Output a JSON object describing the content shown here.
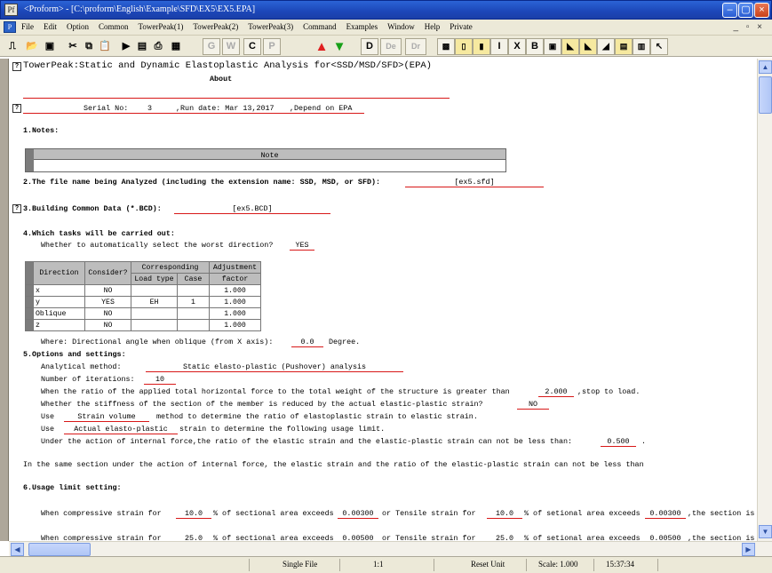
{
  "window": {
    "title": "<Proform> - [C:\\proform\\English\\Example\\SFD\\EX5\\EX5.EPA]",
    "app_icon": "Pf"
  },
  "menu": [
    "File",
    "Edit",
    "Option",
    "Common",
    "TowerPeak(1)",
    "TowerPeak(2)",
    "TowerPeak(3)",
    "Command",
    "Examples",
    "Window",
    "Help",
    "Private"
  ],
  "menu_controls": "_ ▫ ×",
  "toolbar": {
    "g": "G",
    "w": "W",
    "c1": "C",
    "p": "P",
    "d": "D",
    "de": "De",
    "dr": "Dr",
    "i": "I",
    "x": "X",
    "b": "B"
  },
  "doc": {
    "title": "TowerPeak:Static and Dynamic Elastoplastic Analysis for<SSD/MSD/SFD>(EPA)",
    "about": "About",
    "serial_label": "Serial No:",
    "serial_value": "3",
    "run_date": ",Run date: Mar 13,2017",
    "depend": ",Depend on  EPA",
    "s1": "1.Notes:",
    "note_header": "Note",
    "s2": "2.The file name being Analyzed (including the extension name: SSD, MSD, or SFD):",
    "s2_value": "[ex5.sfd]",
    "s3": "3.Building Common Data (*.BCD):",
    "s3_value": "[ex5.BCD]",
    "s4": "4.Which tasks will be carried out:",
    "s4_q": "Whether to automatically select the worst direction?",
    "s4_a": "YES",
    "table": {
      "h_direction": "Direction",
      "h_consider": "Consider?",
      "h_corr": "Corresponding",
      "h_adj": "Adjustment",
      "h_loadtype": "Load type",
      "h_case": "Case",
      "h_factor": "factor",
      "rows": [
        {
          "dir": "x",
          "consider": "NO",
          "load": "",
          "case": "",
          "factor": "1.000"
        },
        {
          "dir": "y",
          "consider": "YES",
          "load": "EH",
          "case": "1",
          "factor": "1.000"
        },
        {
          "dir": "Oblique",
          "consider": "NO",
          "load": "",
          "case": "",
          "factor": "1.000"
        },
        {
          "dir": "z",
          "consider": "NO",
          "load": "",
          "case": "",
          "factor": "1.000"
        }
      ]
    },
    "where": "Where: Directional angle when oblique (from X axis):",
    "where_value": "0.0",
    "where_unit": "Degree.",
    "s5": "5.Options and settings:",
    "method_label": "Analytical method:",
    "method_value": "Static elasto-plastic (Pushover) analysis",
    "iter_label": "Number of iterations:",
    "iter_value": "10",
    "ratio_pre": "When the ratio of the applied total horizontal force to the total weight of the structure is greater than",
    "ratio_value": "2.000",
    "ratio_post": ",stop to load.",
    "stiff_pre": "Whether the stiffness of the section of the member is reduced by the actual elastic-plastic strain?",
    "stiff_value": "NO",
    "use1_pre": "Use",
    "use1_value": "Strain volume",
    "use1_post": "method to determine the ratio of elastoplastic strain to elastic strain.",
    "use2_pre": "Use",
    "use2_value": "Actual elasto-plastic",
    "use2_post": "strain to determine the following usage limit.",
    "under_pre": "Under the action of internal force,the ratio of the elastic strain and the elastic-plastic strain can not be less than:",
    "under_value": "0.500",
    "under_post": ".",
    "same_section": "In the same section under the action of internal force, the elastic strain and the ratio of the elastic-plastic strain can not be less than",
    "s6": "6.Usage limit setting:",
    "ul1": {
      "a": "When compressive strain for",
      "v1": "10.0",
      "b": "% of sectional area exceeds",
      "v2": "0.00300",
      "c": "or Tensile strain for",
      "v3": "10.0",
      "d": "% of setional area exceeds",
      "v4": "0.00300",
      "e": ",the section is"
    },
    "ul2": {
      "a": "When compressive strain for",
      "v1": "25.0",
      "b": "% of sectional area exceeds",
      "v2": "0.00500",
      "c": "or Tensile strain for",
      "v3": "25.0",
      "d": "% of setional area exceeds",
      "v4": "0.00500",
      "e": ",the section is"
    }
  },
  "status": {
    "mode": "Single File",
    "page": "1:1",
    "unit": "Reset Unit",
    "scale": "Scale: 1.000",
    "time": "15:37:34"
  },
  "colors": {
    "title_bar": "#1c47b8",
    "underline": "#d81818",
    "red_arrow": "#e02020",
    "green_arrow": "#18a018"
  }
}
